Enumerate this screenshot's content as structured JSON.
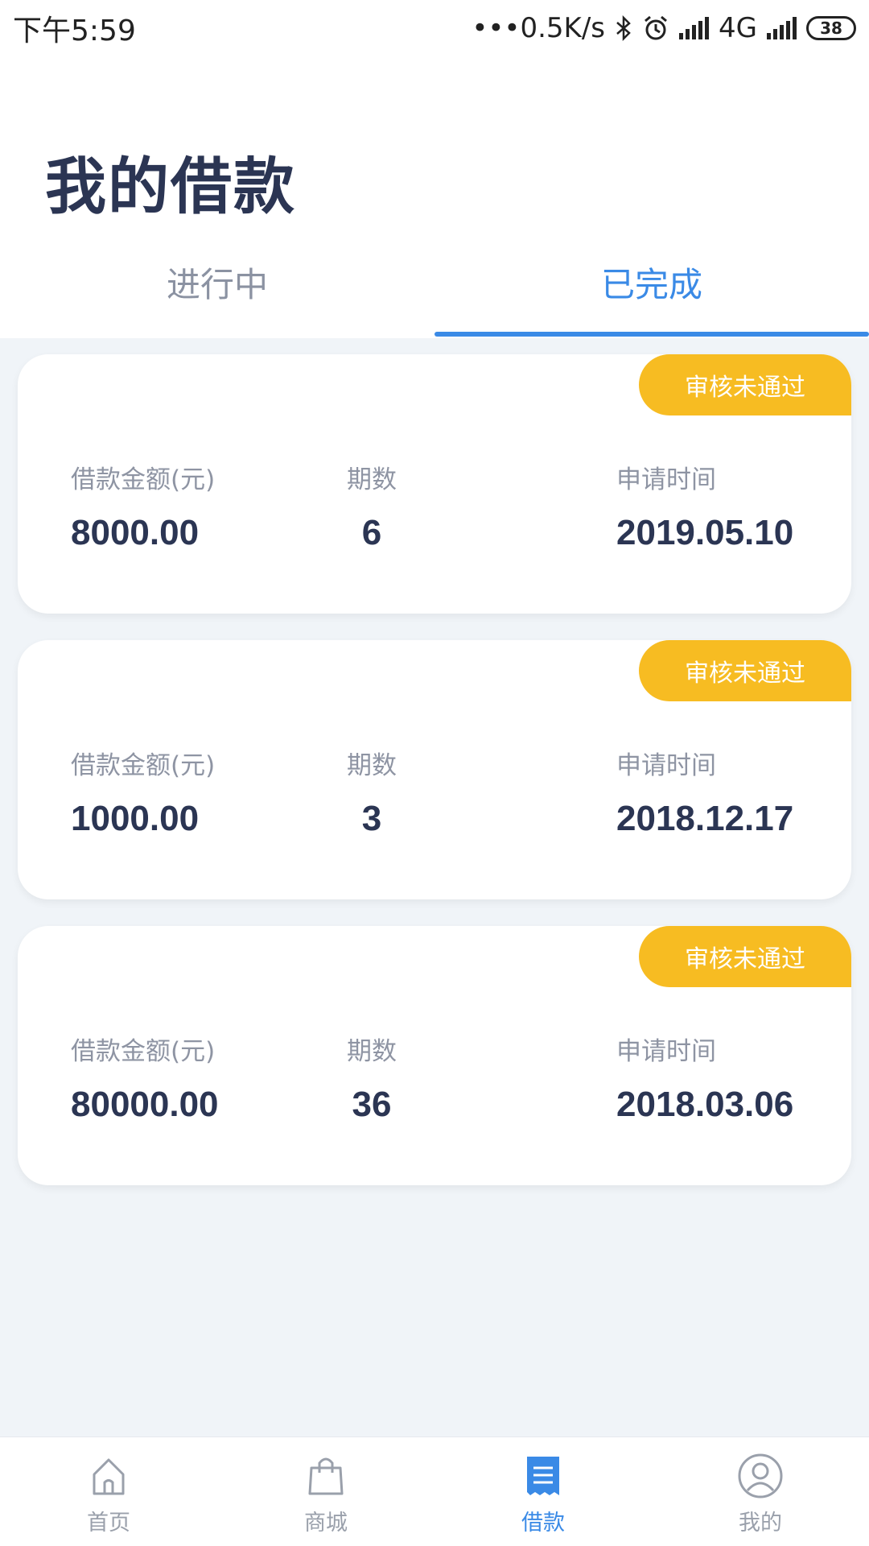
{
  "status_bar": {
    "time": "下午5:59",
    "network_speed": "•••0.5K/s",
    "network_type": "4G",
    "battery": "38",
    "icons": [
      "bluetooth-icon",
      "alarm-icon",
      "signal-icon",
      "signal-icon",
      "battery-icon"
    ]
  },
  "header": {
    "title": "我的借款"
  },
  "tabs": [
    {
      "label": "进行中",
      "active": false
    },
    {
      "label": "已完成",
      "active": true
    }
  ],
  "loans": [
    {
      "status": "审核未通过",
      "amount_label": "借款金额(元)",
      "amount": "8000.00",
      "periods_label": "期数",
      "periods": "6",
      "date_label": "申请时间",
      "date": "2019.05.10"
    },
    {
      "status": "审核未通过",
      "amount_label": "借款金额(元)",
      "amount": "1000.00",
      "periods_label": "期数",
      "periods": "3",
      "date_label": "申请时间",
      "date": "2018.12.17"
    },
    {
      "status": "审核未通过",
      "amount_label": "借款金额(元)",
      "amount": "80000.00",
      "periods_label": "期数",
      "periods": "36",
      "date_label": "申请时间",
      "date": "2018.03.06"
    }
  ],
  "bottom_nav": [
    {
      "label": "首页",
      "icon": "home-icon",
      "active": false
    },
    {
      "label": "商城",
      "icon": "shopping-bag-icon",
      "active": false
    },
    {
      "label": "借款",
      "icon": "document-icon",
      "active": true
    },
    {
      "label": "我的",
      "icon": "profile-icon",
      "active": false
    }
  ],
  "colors": {
    "accent": "#3a8ae6",
    "badge": "#f7bc22",
    "title": "#2b3553",
    "muted": "#8e94a3",
    "background": "#f0f4f8"
  }
}
